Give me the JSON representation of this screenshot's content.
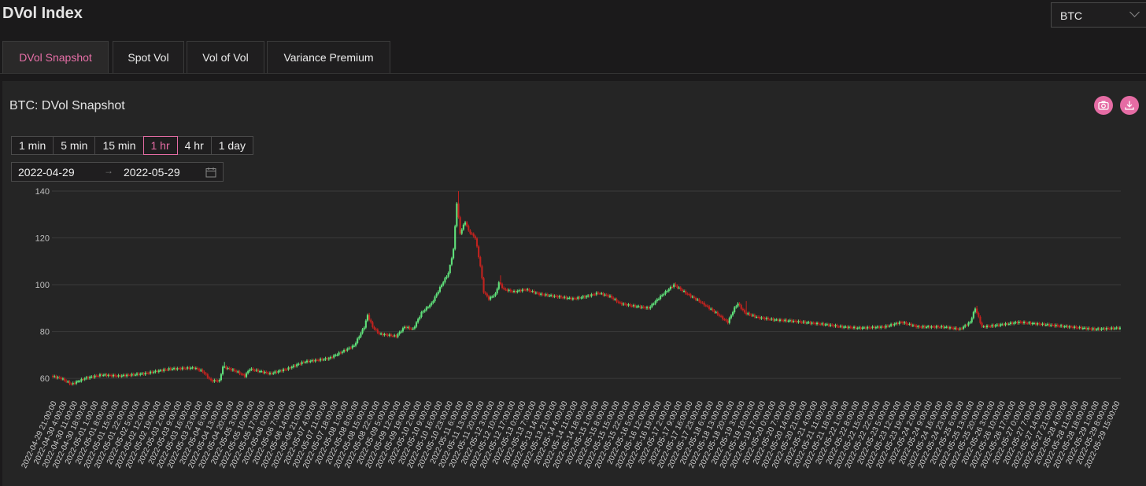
{
  "header": {
    "title": "DVol Index",
    "asset_selected": "BTC"
  },
  "tabs": [
    {
      "label": "DVol Snapshot",
      "active": true
    },
    {
      "label": "Spot Vol",
      "active": false
    },
    {
      "label": "Vol of Vol",
      "active": false
    },
    {
      "label": "Variance Premium",
      "active": false
    }
  ],
  "card": {
    "title": "BTC: DVol Snapshot",
    "camera_icon": "camera-icon",
    "download_icon": "download-icon",
    "ranges": [
      {
        "label": "1 min",
        "active": false
      },
      {
        "label": "5 min",
        "active": false
      },
      {
        "label": "15 min",
        "active": false
      },
      {
        "label": "1 hr",
        "active": true
      },
      {
        "label": "4 hr",
        "active": false
      },
      {
        "label": "1 day",
        "active": false
      }
    ],
    "date_start": "2022-04-29",
    "date_end": "2022-05-29"
  },
  "colors": {
    "accent": "#e56ca4",
    "up": "#5fe07a",
    "down": "#c0231f",
    "grid": "#3a3a3a"
  },
  "chart_data": {
    "type": "candlestick",
    "ylim": [
      55,
      140
    ],
    "yticks": [
      60,
      80,
      100,
      120,
      140
    ],
    "grid": true,
    "x_tick_labels": [
      "2022-04-29 21:00:00",
      "2022-04-30 4:00:00",
      "2022-04-30 11:00:00",
      "2022-04-30 18:00:00",
      "2022-05-01 1:00:00",
      "2022-05-01 8:00:00",
      "2022-05-01 15:00:00",
      "2022-05-01 22:00:00",
      "2022-05-02 5:00:00",
      "2022-05-02 12:00:00",
      "2022-05-02 19:00:00",
      "2022-05-03 2:00:00",
      "2022-05-03 9:00:00",
      "2022-05-03 16:00:00",
      "2022-05-03 23:00:00",
      "2022-05-04 6:00:00",
      "2022-05-04 13:00:00",
      "2022-05-04 20:00:00",
      "2022-05-05 3:00:00",
      "2022-05-05 10:00:00",
      "2022-05-05 17:00:00",
      "2022-05-06 0:00:00",
      "2022-05-06 7:00:00",
      "2022-05-06 14:00:00",
      "2022-05-06 21:00:00",
      "2022-05-07 4:00:00",
      "2022-05-07 11:00:00",
      "2022-05-07 18:00:00",
      "2022-05-08 1:00:00",
      "2022-05-08 8:00:00",
      "2022-05-08 15:00:00",
      "2022-05-08 22:00:00",
      "2022-05-09 5:00:00",
      "2022-05-09 12:00:00",
      "2022-05-09 19:00:00",
      "2022-05-10 2:00:00",
      "2022-05-10 9:00:00",
      "2022-05-10 16:00:00",
      "2022-05-10 23:00:00",
      "2022-05-11 6:00:00",
      "2022-05-11 13:00:00",
      "2022-05-11 20:00:00",
      "2022-05-12 3:00:00",
      "2022-05-12 10:00:00",
      "2022-05-12 17:00:00",
      "2022-05-13 0:00:00",
      "2022-05-13 7:00:00",
      "2022-05-13 14:00:00",
      "2022-05-13 21:00:00",
      "2022-05-14 4:00:00",
      "2022-05-14 11:00:00",
      "2022-05-14 18:00:00",
      "2022-05-15 1:00:00",
      "2022-05-15 8:00:00",
      "2022-05-15 15:00:00",
      "2022-05-15 22:00:00",
      "2022-05-16 5:00:00",
      "2022-05-16 12:00:00",
      "2022-05-16 19:00:00",
      "2022-05-17 2:00:00",
      "2022-05-17 9:00:00",
      "2022-05-17 16:00:00",
      "2022-05-17 23:00:00",
      "2022-05-18 6:00:00",
      "2022-05-18 13:00:00",
      "2022-05-18 20:00:00",
      "2022-05-19 3:00:00",
      "2022-05-19 10:00:00",
      "2022-05-19 17:00:00",
      "2022-05-20 0:00:00",
      "2022-05-20 7:00:00",
      "2022-05-20 14:00:00",
      "2022-05-20 21:00:00",
      "2022-05-21 4:00:00",
      "2022-05-21 11:00:00",
      "2022-05-21 18:00:00",
      "2022-05-22 1:00:00",
      "2022-05-22 8:00:00",
      "2022-05-22 15:00:00",
      "2022-05-22 22:00:00",
      "2022-05-23 5:00:00",
      "2022-05-23 12:00:00",
      "2022-05-23 19:00:00",
      "2022-05-24 2:00:00",
      "2022-05-24 9:00:00",
      "2022-05-24 16:00:00",
      "2022-05-24 23:00:00",
      "2022-05-25 6:00:00",
      "2022-05-25 13:00:00",
      "2022-05-25 20:00:00",
      "2022-05-26 3:00:00",
      "2022-05-26 10:00:00",
      "2022-05-26 17:00:00",
      "2022-05-27 0:00:00",
      "2022-05-27 7:00:00",
      "2022-05-27 14:00:00",
      "2022-05-27 21:00:00",
      "2022-05-28 4:00:00",
      "2022-05-28 11:00:00",
      "2022-05-28 18:00:00",
      "2022-05-29 1:00:00",
      "2022-05-29 8:00:00",
      "2022-05-29 15:00:00"
    ],
    "anchors": [
      [
        0,
        61
      ],
      [
        6,
        60
      ],
      [
        12,
        57.5
      ],
      [
        20,
        60
      ],
      [
        30,
        61.5
      ],
      [
        40,
        61
      ],
      [
        55,
        62
      ],
      [
        70,
        64
      ],
      [
        85,
        64.5
      ],
      [
        90,
        63
      ],
      [
        95,
        59
      ],
      [
        100,
        59
      ],
      [
        102,
        65
      ],
      [
        110,
        63
      ],
      [
        115,
        61
      ],
      [
        118,
        64
      ],
      [
        130,
        62
      ],
      [
        140,
        64
      ],
      [
        150,
        67
      ],
      [
        165,
        68.5
      ],
      [
        180,
        74
      ],
      [
        186,
        82
      ],
      [
        188,
        87
      ],
      [
        191,
        82
      ],
      [
        195,
        79
      ],
      [
        205,
        78
      ],
      [
        210,
        82
      ],
      [
        215,
        81
      ],
      [
        220,
        88
      ],
      [
        226,
        92
      ],
      [
        232,
        100
      ],
      [
        236,
        105
      ],
      [
        239,
        115
      ],
      [
        241,
        135
      ],
      [
        243,
        122
      ],
      [
        246,
        127
      ],
      [
        248,
        123
      ],
      [
        252,
        120
      ],
      [
        255,
        108
      ],
      [
        257,
        97
      ],
      [
        260,
        94
      ],
      [
        264,
        96
      ],
      [
        266,
        101
      ],
      [
        269,
        98
      ],
      [
        275,
        97
      ],
      [
        282,
        98
      ],
      [
        290,
        96
      ],
      [
        300,
        95
      ],
      [
        310,
        94
      ],
      [
        318,
        95
      ],
      [
        325,
        96.5
      ],
      [
        332,
        95
      ],
      [
        338,
        92
      ],
      [
        345,
        91
      ],
      [
        355,
        90
      ],
      [
        362,
        95
      ],
      [
        370,
        100
      ],
      [
        372,
        99
      ],
      [
        378,
        96
      ],
      [
        385,
        93
      ],
      [
        395,
        88
      ],
      [
        400,
        85
      ],
      [
        402,
        84
      ],
      [
        406,
        90
      ],
      [
        408,
        92
      ],
      [
        412,
        88
      ],
      [
        420,
        86
      ],
      [
        430,
        85
      ],
      [
        440,
        84.5
      ],
      [
        460,
        83
      ],
      [
        470,
        82
      ],
      [
        480,
        81.5
      ],
      [
        495,
        82
      ],
      [
        505,
        84
      ],
      [
        515,
        82
      ],
      [
        530,
        82
      ],
      [
        540,
        81
      ],
      [
        546,
        84
      ],
      [
        549,
        90
      ],
      [
        553,
        82
      ],
      [
        560,
        82.5
      ],
      [
        575,
        84
      ],
      [
        590,
        83
      ],
      [
        605,
        82
      ],
      [
        620,
        81
      ],
      [
        634,
        81.5
      ]
    ],
    "spikes": [
      [
        241,
        140
      ],
      [
        188,
        88
      ],
      [
        236,
        108
      ],
      [
        266,
        104
      ],
      [
        549,
        91
      ],
      [
        412,
        93
      ],
      [
        102,
        67
      ],
      [
        370,
        101
      ]
    ]
  }
}
